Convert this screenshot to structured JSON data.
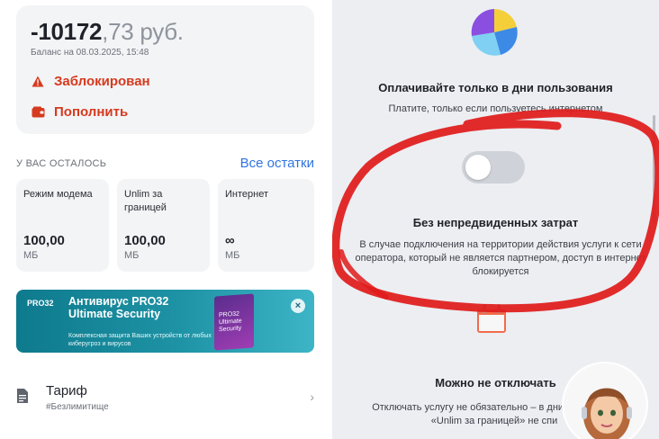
{
  "balance": {
    "amount_int": "-10172",
    "amount_dec": ",73 руб.",
    "date": "Баланс на 08.03.2025, 15:48",
    "blocked_label": "Заблокирован",
    "topup_label": "Пополнить"
  },
  "remaining": {
    "header": "У ВАС ОСТАЛОСЬ",
    "all_link": "Все остатки",
    "tiles": [
      {
        "label": "Режим модема",
        "value": "100,00",
        "unit": "МБ"
      },
      {
        "label": "Unlim за границей",
        "value": "100,00",
        "unit": "МБ"
      },
      {
        "label": "Интернет",
        "value": "∞",
        "unit": "МБ"
      }
    ]
  },
  "banner": {
    "logo": "PRO32",
    "title": "Антивирус PRO32 Ultimate Security",
    "subtitle": "Комплексная защита Ваших устройств от любых киберугроз и вирусов",
    "box_label": "PRO32 Ultimate Security",
    "close_glyph": "×"
  },
  "tariff": {
    "title": "Тариф",
    "subtitle": "#Безлимитище",
    "arrow": "›"
  },
  "right": {
    "h1": "Оплачивайте только в дни пользования",
    "p1": "Платите, только если пользуетесь интернетом",
    "h2": "Без непредвиденных затрат",
    "p2": "В случае подключения на территории действия услуги к сети оператора, который не является партнером, доступ в интернет блокируется",
    "h3": "Можно не отключать",
    "p3": "Отключать услугу не обязательно – в дни, стоимость «Unlim за границей» не спи"
  },
  "colors": {
    "accent_red": "#d63a1e",
    "link_blue": "#2f74e0",
    "scribble_red": "#e01a1a"
  },
  "icons": [
    "warning-icon",
    "wallet-icon",
    "document-icon",
    "pie-chart-icon",
    "calendar-icon",
    "close-icon",
    "chevron-right-icon"
  ]
}
